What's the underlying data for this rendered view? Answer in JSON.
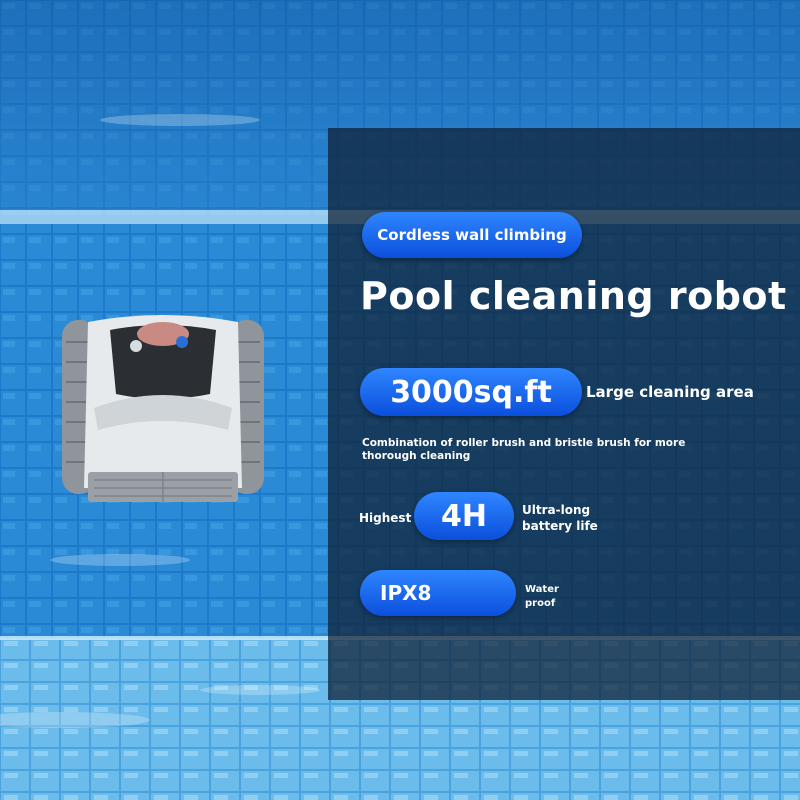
{
  "badge": "Cordless wall climbing",
  "title": "Pool cleaning robot",
  "area": {
    "value": "3000sq.ft",
    "label": "Large cleaning area"
  },
  "brush_text_line1": "Combination of roller brush and bristle brush for more",
  "brush_text_line2": "thorough cleaning",
  "battery": {
    "prefix": "Highest",
    "value": "4H",
    "label_line1": "Ultra-long",
    "label_line2": "battery life"
  },
  "waterproof": {
    "value": "IPX8",
    "label_line1": "Water",
    "label_line2": "proof"
  },
  "colors": {
    "pill": "#1e66f0",
    "panel": "#0f1e32",
    "water": "#1a73c4"
  }
}
